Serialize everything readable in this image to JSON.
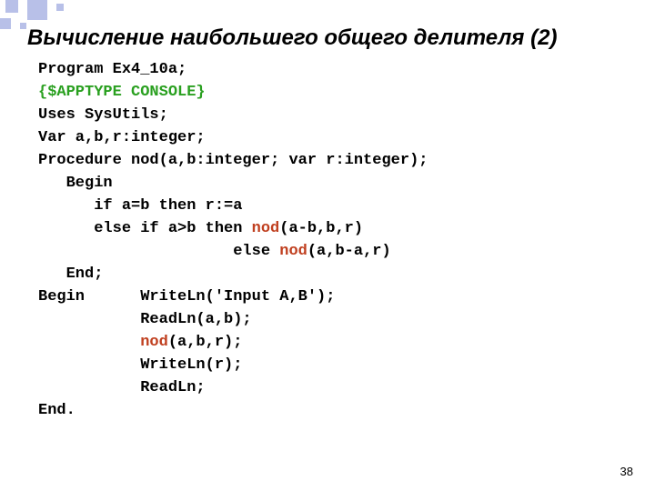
{
  "title": "Вычисление наибольшего общего делителя (2)",
  "slide_number": "38",
  "code": {
    "l1": "Program Ex4_10a;",
    "l2": "{$APPTYPE CONSOLE}",
    "l3": "Uses SysUtils;",
    "l4": "Var a,b,r:integer;",
    "l5": "Procedure nod(a,b:integer; var r:integer);",
    "l6": "   Begin",
    "l7": "      if a=b then r:=a",
    "l8a": "      else if a>b then ",
    "l8b": "nod",
    "l8c": "(a-b,b,r)",
    "l9a": "                     else ",
    "l9b": "nod",
    "l9c": "(a,b-a,r)",
    "l10": "   End;",
    "l11": "Begin      WriteLn('Input A,B');",
    "l12": "           ReadLn(a,b);",
    "l13a": "           ",
    "l13b": "nod",
    "l13c": "(a,b,r);",
    "l14": "           WriteLn(r);",
    "l15": "           ReadLn;",
    "l16": "End."
  }
}
